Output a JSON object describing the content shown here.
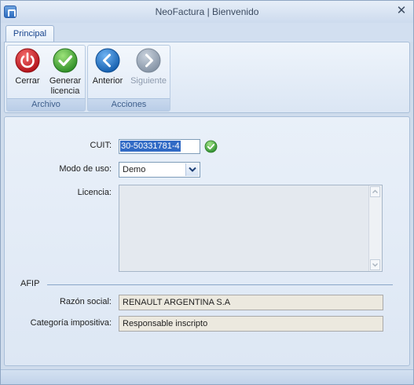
{
  "window": {
    "title": "NeoFactura | Bienvenido",
    "close_glyph": "✕"
  },
  "tabs": [
    {
      "label": "Principal"
    }
  ],
  "ribbon": {
    "groups": [
      {
        "label": "Archivo",
        "buttons": [
          {
            "label": "Cerrar",
            "icon": "power-icon"
          },
          {
            "label": "Generar\nlicencia",
            "icon": "check-icon"
          }
        ]
      },
      {
        "label": "Acciones",
        "buttons": [
          {
            "label": "Anterior",
            "icon": "arrow-left-icon"
          },
          {
            "label": "Siguiente",
            "icon": "arrow-right-icon",
            "disabled": true
          }
        ]
      }
    ]
  },
  "form": {
    "cuit_label": "CUIT:",
    "cuit_value": "30-50331781-4",
    "modo_label": "Modo de uso:",
    "modo_value": "Demo",
    "licencia_label": "Licencia:",
    "licencia_value": "",
    "afip_section": "AFIP",
    "razon_label": "Razón social:",
    "razon_value": "RENAULT ARGENTINA S.A",
    "categoria_label": "Categoría impositiva:",
    "categoria_value": "Responsable inscripto"
  },
  "colors": {
    "accent": "#15428b",
    "close_red": "#d8232a",
    "ok_green": "#3aa335",
    "nav_blue": "#1f73c7"
  }
}
